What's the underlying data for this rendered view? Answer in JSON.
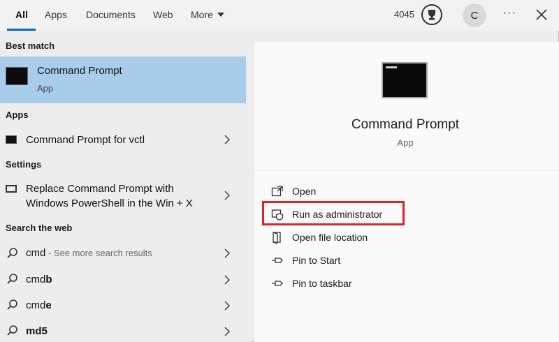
{
  "tabs": [
    {
      "label": "All",
      "active": true
    },
    {
      "label": "Apps"
    },
    {
      "label": "Documents"
    },
    {
      "label": "Web"
    },
    {
      "label": "More"
    }
  ],
  "header": {
    "points": "4045",
    "avatar_initial": "C",
    "more_options": "···"
  },
  "left": {
    "best_match_heading": "Best match",
    "best_match": {
      "name": "Command Prompt",
      "type": "App"
    },
    "apps_heading": "Apps",
    "apps": [
      {
        "label": "Command Prompt for vctl"
      }
    ],
    "settings_heading": "Settings",
    "settings": [
      {
        "line1": "Replace Command Prompt with",
        "line2": "Windows PowerShell in the Win + X"
      }
    ],
    "web_heading": "Search the web",
    "web": [
      {
        "query": "cmd",
        "suffix": " - See more search results"
      },
      {
        "prefix": "cmd",
        "bold": "b"
      },
      {
        "prefix": "cmd",
        "bold": "e"
      },
      {
        "query": "md5"
      }
    ]
  },
  "right": {
    "title": "Command Prompt",
    "subtitle": "App",
    "actions": [
      {
        "label": "Open",
        "icon": "open-icon"
      },
      {
        "label": "Run as administrator",
        "icon": "shield-icon"
      },
      {
        "label": "Open file location",
        "icon": "file-location-icon"
      },
      {
        "label": "Pin to Start",
        "icon": "pin-icon"
      },
      {
        "label": "Pin to taskbar",
        "icon": "pin-icon"
      }
    ]
  },
  "colors": {
    "selection": "#a8cdea",
    "accent": "#0067c0",
    "highlight_box": "#e0202a"
  }
}
